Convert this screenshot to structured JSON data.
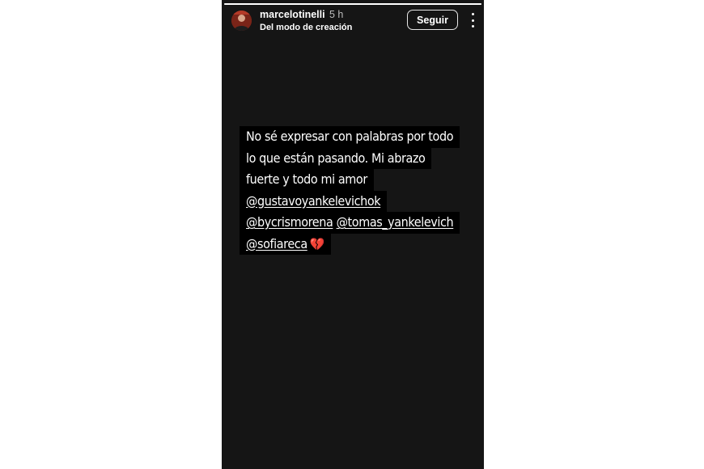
{
  "story": {
    "progress": 1.0,
    "header": {
      "username": "marcelotinelli",
      "time": "5 h",
      "subtitle": "Del modo de creación",
      "follow_label": "Seguir",
      "menu_icon": "more-vertical-icon",
      "avatar_icon": "profile-avatar"
    },
    "caption": {
      "line1": "No sé expresar con palabras por todo",
      "line2": "lo que están pasando. Mi abrazo",
      "line3": "fuerte y todo mi amor",
      "mention1": "@gustavoyankelevichok",
      "mention2": "@bycrismorena",
      "mention3": "@tomas_yankelevich",
      "mention4": "@sofiareca",
      "emoji": "broken-heart-icon"
    }
  },
  "colors": {
    "story_background": "#151515",
    "page_background": "#ffffff",
    "text": "#ffffff",
    "text_highlight": "#000000",
    "heart": "#e02f2f"
  }
}
